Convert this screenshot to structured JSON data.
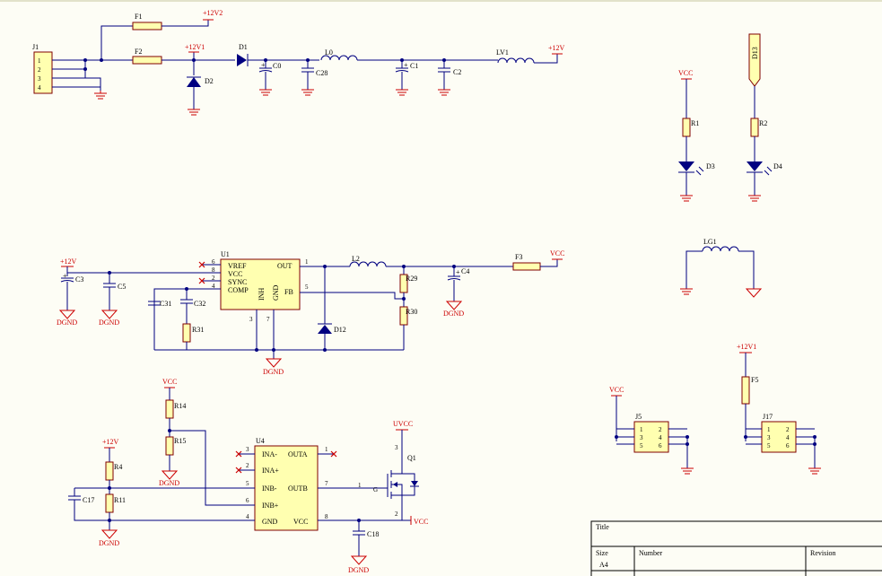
{
  "components": {
    "J1": {
      "ref": "J1",
      "pins": [
        "1",
        "2",
        "3",
        "4"
      ]
    },
    "F1": "F1",
    "F2": "F2",
    "F3": "F3",
    "F5": "F5",
    "D1": "D1",
    "D2": "D2",
    "D3": "D3",
    "D4": "D4",
    "D12": "D12",
    "D13": "D13",
    "L0": "L0",
    "L2": "L2",
    "LV1": "LV1",
    "LG1": "LG1",
    "C0": "C0",
    "C1": "C1",
    "C2": "C2",
    "C3": "C3",
    "C4": "C4",
    "C5": "C5",
    "C17": "C17",
    "C18": "C18",
    "C28": "C28",
    "C31": "C31",
    "C32": "C32",
    "R1": "R1",
    "R2": "R2",
    "R4": "R4",
    "R11": "R11",
    "R14": "R14",
    "R15": "R15",
    "R29": "R29",
    "R30": "R30",
    "R31": "R31",
    "Q1": "Q1",
    "J5": "J5",
    "J17": "J17",
    "U1": {
      "ref": "U1",
      "left_pins": [
        "VREF",
        "VCC",
        "SYNC",
        "COMP"
      ],
      "left_nums": [
        "6",
        "8",
        "2",
        "4"
      ],
      "bottom_pins": [
        "INH",
        "GND"
      ],
      "bottom_nums": [
        "3",
        "7"
      ],
      "right_pins": [
        "OUT",
        "FB"
      ],
      "right_nums": [
        "1",
        "5"
      ]
    },
    "U4": {
      "ref": "U4",
      "left_pins": [
        "INA-",
        "INA+",
        "INB-",
        "INB+",
        "GND"
      ],
      "left_nums": [
        "3",
        "2",
        "5",
        "6",
        "4"
      ],
      "right_pins": [
        "OUTA",
        "OUTB",
        "VCC"
      ],
      "right_nums": [
        "1",
        "7",
        "8"
      ]
    },
    "J5_pins": [
      "1",
      "2",
      "3",
      "4",
      "5",
      "6"
    ],
    "J17_pins": [
      "1",
      "2",
      "3",
      "4",
      "5",
      "6"
    ],
    "Q1_pins": {
      "g": "G",
      "pin1": "1",
      "pin2": "2",
      "pin3": "3"
    }
  },
  "nets": {
    "p12v2": "+12V2",
    "p12v1": "+12V1",
    "p12v": "+12V",
    "vcc": "VCC",
    "uvcc": "UVCC",
    "dgnd": "DGND"
  },
  "title_block": {
    "title": "Title",
    "size": "Size",
    "size_val": "A4",
    "number": "Number",
    "revision": "Revision"
  }
}
